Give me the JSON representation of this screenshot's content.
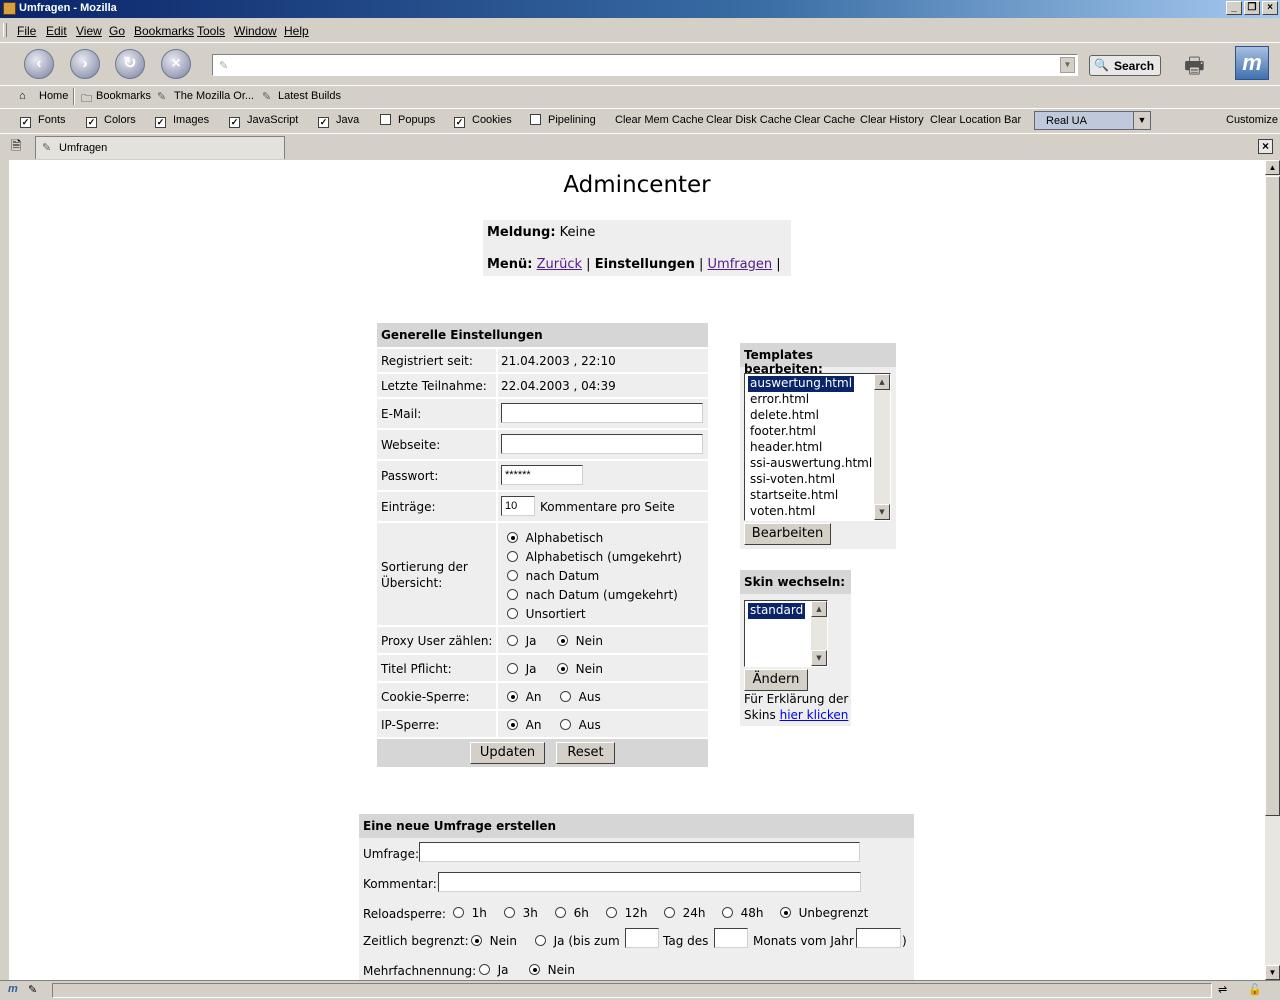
{
  "window": {
    "title": "Umfragen - Mozilla",
    "controls": [
      "_",
      "❐",
      "×"
    ]
  },
  "menu": [
    "File",
    "Edit",
    "View",
    "Go",
    "Bookmarks",
    "Tools",
    "Window",
    "Help"
  ],
  "nav": {
    "search_label": "Search",
    "url_value": ""
  },
  "personal_toolbar": [
    "Home",
    "Bookmarks",
    "The Mozilla Or...",
    "Latest Builds"
  ],
  "prefbar": {
    "toggles": [
      {
        "label": "Fonts",
        "checked": true
      },
      {
        "label": "Colors",
        "checked": true
      },
      {
        "label": "Images",
        "checked": true
      },
      {
        "label": "JavaScript",
        "checked": true
      },
      {
        "label": "Java",
        "checked": true
      },
      {
        "label": "Popups",
        "checked": false
      },
      {
        "label": "Cookies",
        "checked": true
      },
      {
        "label": "Pipelining",
        "checked": false
      }
    ],
    "actions": [
      "Clear Mem Cache",
      "Clear Disk Cache",
      "Clear Cache",
      "Clear History",
      "Clear Location Bar"
    ],
    "ua_select": "Real UA",
    "customize": "Customize"
  },
  "tab": {
    "label": "Umfragen"
  },
  "page": {
    "title": "Admincenter",
    "meldung_label": "Meldung:",
    "meldung_value": "Keine",
    "menu_label": "Menü:",
    "menu_links": [
      "Zurück",
      "Einstellungen",
      "Umfragen"
    ],
    "sep": "|"
  },
  "settings": {
    "header": "Generelle Einstellungen",
    "registered_label": "Registriert seit:",
    "registered_value": "21.04.2003 , 22:10",
    "last_label": "Letzte Teilnahme:",
    "last_value": "22.04.2003 , 04:39",
    "email_label": "E-Mail:",
    "email_value": "",
    "website_label": "Webseite:",
    "website_value": "",
    "password_label": "Passwort:",
    "password_value": "******",
    "entries_label": "Einträge:",
    "entries_value": "10",
    "entries_suffix": "Kommentare pro Seite",
    "sort_label": "Sortierung der Übersicht:",
    "sort_options": [
      "Alphabetisch",
      "Alphabetisch (umgekehrt)",
      "nach Datum",
      "nach Datum (umgekehrt)",
      "Unsortiert"
    ],
    "sort_selected": 0,
    "proxy_label": "Proxy User zählen:",
    "titel_label": "Titel Pflicht:",
    "cookie_label": "Cookie-Sperre:",
    "ip_label": "IP-Sperre:",
    "ja": "Ja",
    "nein": "Nein",
    "an": "An",
    "aus": "Aus",
    "update_btn": "Updaten",
    "reset_btn": "Reset"
  },
  "templates": {
    "header": "Templates bearbeiten:",
    "items": [
      "auswertung.html",
      "error.html",
      "delete.html",
      "footer.html",
      "header.html",
      "ssi-auswertung.html",
      "ssi-voten.html",
      "startseite.html",
      "voten.html"
    ],
    "selected": 0,
    "button": "Bearbeiten"
  },
  "skin": {
    "header": "Skin wechseln:",
    "items": [
      "standard"
    ],
    "button": "Ändern",
    "note_line1": "Für Erklärung der",
    "note_line2": "Skins",
    "note_link": "hier klicken"
  },
  "new_poll": {
    "header": "Eine neue Umfrage erstellen",
    "umfrage_label": "Umfrage:",
    "kommentar_label": "Kommentar:",
    "reload_label": "Reloadsperre:",
    "reload_options": [
      "1h",
      "3h",
      "6h",
      "12h",
      "24h",
      "48h",
      "Unbegrenzt"
    ],
    "reload_selected": 6,
    "zeit_label": "Zeitlich begrenzt:",
    "zeit_nein": "Nein",
    "zeit_ja": "Ja (bis zum",
    "tag_des": "Tag des",
    "monats": "Monats vom Jahr",
    "close_paren": ")",
    "mehr_label": "Mehrfachnennung:",
    "mehr_ja": "Ja",
    "mehr_nein": "Nein"
  }
}
